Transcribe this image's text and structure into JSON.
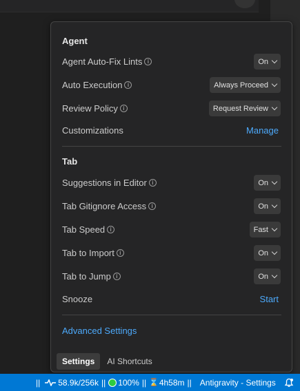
{
  "agent": {
    "title": "Agent",
    "auto_fix_lints": {
      "label": "Agent Auto-Fix Lints",
      "value": "On"
    },
    "auto_execution": {
      "label": "Auto Execution",
      "value": "Always Proceed"
    },
    "review_policy": {
      "label": "Review Policy",
      "value": "Request Review"
    },
    "customizations": {
      "label": "Customizations",
      "action": "Manage"
    }
  },
  "tab": {
    "title": "Tab",
    "suggestions": {
      "label": "Suggestions in Editor",
      "value": "On"
    },
    "gitignore": {
      "label": "Tab Gitignore Access",
      "value": "On"
    },
    "speed": {
      "label": "Tab Speed",
      "value": "Fast"
    },
    "import": {
      "label": "Tab to Import",
      "value": "On"
    },
    "jump": {
      "label": "Tab to Jump",
      "value": "On"
    },
    "snooze": {
      "label": "Snooze",
      "action": "Start"
    }
  },
  "advanced_settings": "Advanced Settings",
  "footer_tabs": [
    "Settings",
    "AI Shortcuts"
  ],
  "statusbar": {
    "sep_start": "||",
    "tokens": "58.9k/256k",
    "sep1": "||",
    "battery": "100%",
    "sep2": "||",
    "time": "4h58m",
    "sep3": "||",
    "app": "Antigravity - Settings"
  },
  "colors": {
    "accent": "#4daafc",
    "statusbar": "#0078d4",
    "panel": "#252526"
  }
}
